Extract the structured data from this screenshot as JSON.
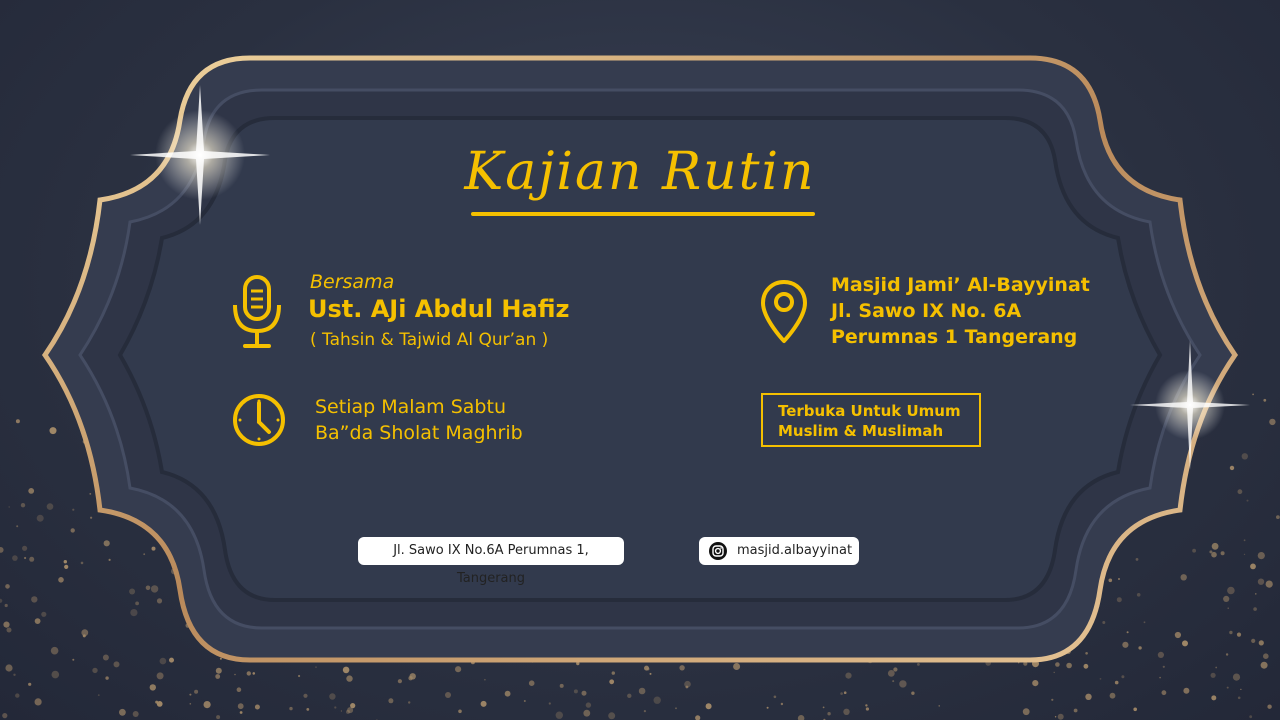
{
  "title": "Kajian Rutin",
  "speaker": {
    "prefix": "Bersama",
    "name": "Ust. AJi Abdul Hafiz",
    "topic": "( Tahsin & Tajwid Al Qur’an )"
  },
  "schedule": {
    "line1": "Setiap Malam Sabtu",
    "line2": "Ba”da Sholat Maghrib"
  },
  "location": {
    "line1": "Masjid Jami’ Al-Bayyinat",
    "line2": "Jl. Sawo IX No. 6A",
    "line3": "Perumnas 1 Tangerang"
  },
  "audience": {
    "line1": "Terbuka Untuk Umum",
    "line2": "Muslim & Muslimah"
  },
  "footer": {
    "address": "Jl. Sawo IX No.6A Perumnas 1, Tangerang",
    "instagram": "masjid.albayyinat"
  },
  "icons": [
    "microphone-icon",
    "clock-icon",
    "location-pin-icon",
    "instagram-icon"
  ],
  "colors": {
    "accent": "#f5c000",
    "background": "#2e3446"
  }
}
